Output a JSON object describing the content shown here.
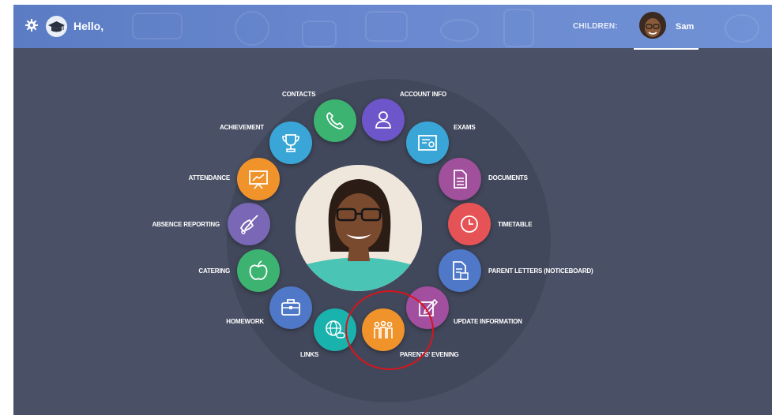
{
  "header": {
    "greeting": "Hello,",
    "children_label": "CHILDREN:",
    "child_name": "Sam",
    "icons": [
      "gear-icon",
      "graduation-cap-icon"
    ]
  },
  "menu": {
    "items": [
      {
        "id": "contacts",
        "label": "CONTACTS",
        "color": "#3cb371",
        "icon": "phone-icon"
      },
      {
        "id": "account-info",
        "label": "ACCOUNT INFO",
        "color": "#6d56c9",
        "icon": "user-icon"
      },
      {
        "id": "exams",
        "label": "EXAMS",
        "color": "#3aa6d8",
        "icon": "certificate-icon"
      },
      {
        "id": "documents",
        "label": "DOCUMENTS",
        "color": "#a1509c",
        "icon": "document-icon"
      },
      {
        "id": "timetable",
        "label": "TIMETABLE",
        "color": "#e65356",
        "icon": "clock-icon"
      },
      {
        "id": "parent-letters",
        "label": "PARENT LETTERS (NOTICEBOARD)",
        "color": "#4f79c8",
        "icon": "letter-icon"
      },
      {
        "id": "update-information",
        "label": "UPDATE INFORMATION",
        "color": "#a24fa0",
        "icon": "edit-icon"
      },
      {
        "id": "parents-evening",
        "label": "PARENTS' EVENING",
        "color": "#f0932b",
        "icon": "people-icon"
      },
      {
        "id": "links",
        "label": "LINKS",
        "color": "#1ab2ad",
        "icon": "globe-link-icon"
      },
      {
        "id": "homework",
        "label": "HOMEWORK",
        "color": "#4f79c8",
        "icon": "briefcase-icon"
      },
      {
        "id": "catering",
        "label": "CATERING",
        "color": "#3cb371",
        "icon": "apple-icon"
      },
      {
        "id": "absence-reporting",
        "label": "ABSENCE REPORTING",
        "color": "#7a67b5",
        "icon": "bell-icon"
      },
      {
        "id": "attendance",
        "label": "ATTENDANCE",
        "color": "#f0932b",
        "icon": "presentation-chart-icon"
      },
      {
        "id": "achievement",
        "label": "ACHIEVEMENT",
        "color": "#3aa6d8",
        "icon": "trophy-icon"
      }
    ]
  }
}
